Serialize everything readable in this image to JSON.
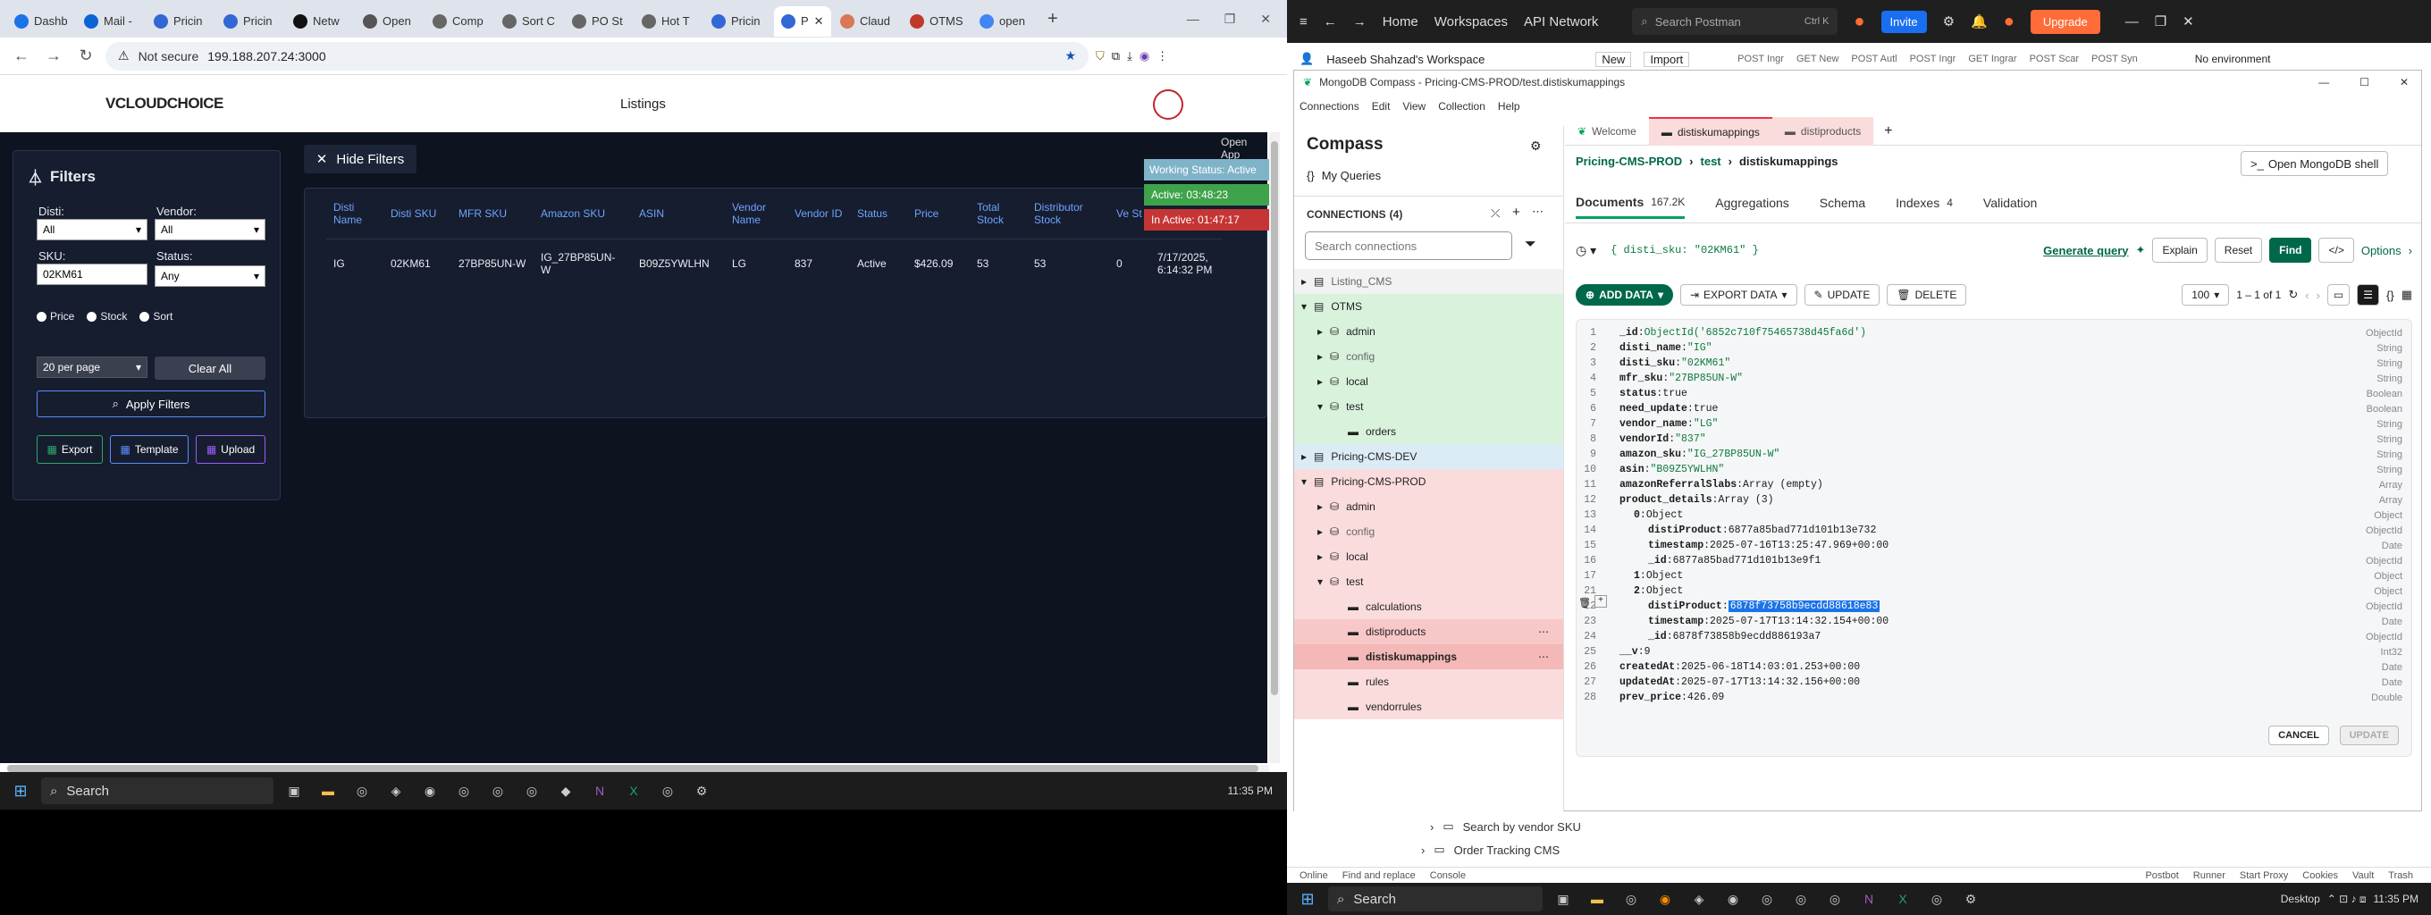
{
  "chrome": {
    "tabs": [
      "Dashb",
      "Mail -",
      "Pricin",
      "Pricin",
      "Netw",
      "Open",
      "Comp",
      "Sort C",
      "PO St",
      "Hot T",
      "Pricin",
      "P",
      "Claud",
      "OTMS",
      "open"
    ],
    "new_tab": "+",
    "not_secure": "Not secure",
    "url": "199.188.207.24:3000"
  },
  "app": {
    "logo": "VCLOUDCHOICE",
    "title": "Listings",
    "open_app": "Open App",
    "hide_filters": "Hide Filters",
    "filters_title": "Filters",
    "disti_label": "Disti:",
    "disti_value": "All",
    "vendor_label": "Vendor:",
    "vendor_value": "All",
    "sku_label": "SKU:",
    "sku_value": "02KM61",
    "status_label": "Status:",
    "status_value": "Any",
    "radio_price": "Price",
    "radio_stock": "Stock",
    "radio_sort": "Sort",
    "per_page": "20 per page",
    "clear_all": "Clear All",
    "apply_filters": "Apply Filters",
    "export": "Export",
    "template": "Template",
    "upload": "Upload",
    "working_status": "Working Status: Active",
    "active_time": "Active: 03:48:23",
    "inactive_time": "In Active: 01:47:17",
    "columns": [
      "Disti Name",
      "Disti SKU",
      "MFR SKU",
      "Amazon SKU",
      "ASIN",
      "Vendor Name",
      "Vendor ID",
      "Status",
      "Price",
      "Total Stock",
      "Distributor Stock",
      "Ve St"
    ],
    "row": [
      "IG",
      "02KM61",
      "27BP85UN-W",
      "IG_27BP85UN-W",
      "B09Z5YWLHN",
      "LG",
      "837",
      "Active",
      "$426.09",
      "53",
      "53",
      "0",
      "7/17/2025, 6:14:32 PM"
    ]
  },
  "taskbar_left": {
    "search": "Search",
    "time": "11:35 PM"
  },
  "postman": {
    "home": "Home",
    "workspaces": "Workspaces",
    "api_network": "API Network",
    "search": "Search Postman",
    "shortcut": "Ctrl K",
    "invite": "Invite",
    "upgrade": "Upgrade",
    "workspace_name": "Haseeb Shahzad's Workspace",
    "new": "New",
    "import": "Import",
    "req_tabs": [
      "POST Ingr",
      "GET New",
      "POST Autl",
      "POST Ingr",
      "GET Ingrar",
      "POST Scar",
      "POST Syn"
    ],
    "no_env": "No environment",
    "bottom_items": [
      "Search by vendor SKU",
      "Order Tracking CMS"
    ],
    "status_left": [
      "Online",
      "Find and replace",
      "Console"
    ],
    "status_right": [
      "Postbot",
      "Runner",
      "Start Proxy",
      "Cookies",
      "Vault",
      "Trash"
    ]
  },
  "compass": {
    "window_title": "MongoDB Compass - Pricing-CMS-PROD/test.distiskumappings",
    "menu": [
      "Connections",
      "Edit",
      "View",
      "Collection",
      "Help"
    ],
    "brand": "Compass",
    "my_queries": "My Queries",
    "connections_label": "CONNECTIONS",
    "connections_count": "(4)",
    "search_connections": "Search connections",
    "tree": [
      {
        "label": "Listing_CMS",
        "level": 0
      },
      {
        "label": "OTMS",
        "level": 0
      },
      {
        "label": "admin",
        "level": 1
      },
      {
        "label": "config",
        "level": 1
      },
      {
        "label": "local",
        "level": 1
      },
      {
        "label": "test",
        "level": 1
      },
      {
        "label": "orders",
        "level": 2
      },
      {
        "label": "Pricing-CMS-DEV",
        "level": 0
      },
      {
        "label": "Pricing-CMS-PROD",
        "level": 0
      },
      {
        "label": "admin",
        "level": 1
      },
      {
        "label": "config",
        "level": 1
      },
      {
        "label": "local",
        "level": 1
      },
      {
        "label": "test",
        "level": 1
      },
      {
        "label": "calculations",
        "level": 2
      },
      {
        "label": "distiproducts",
        "level": 2
      },
      {
        "label": "distiskumappings",
        "level": 2
      },
      {
        "label": "rules",
        "level": 2
      },
      {
        "label": "vendorrules",
        "level": 2
      }
    ],
    "tabs": [
      "Welcome",
      "distiskumappings",
      "distiproducts"
    ],
    "breadcrumb": [
      "Pricing-CMS-PROD",
      "test",
      "distiskumappings"
    ],
    "open_shell": "Open MongoDB shell",
    "subtabs": [
      "Documents",
      "Aggregations",
      "Schema",
      "Indexes",
      "Validation"
    ],
    "documents_count": "167.2K",
    "indexes_count": "4",
    "query": "{ disti_sku: \"02KM61\" }",
    "generate_query": "Generate query",
    "explain": "Explain",
    "reset": "Reset",
    "find": "Find",
    "options": "Options",
    "add_data": "ADD DATA",
    "export_data": "EXPORT DATA",
    "update": "UPDATE",
    "delete": "DELETE",
    "page_size": "100",
    "range": "1 – 1 of 1",
    "cancel": "CANCEL",
    "update_btn": "UPDATE",
    "doc_lines": [
      {
        "k": "_id",
        "v": "ObjectId('6852c710f75465738d45fa6d')",
        "t": "ObjectId",
        "i": 0,
        "c": "s"
      },
      {
        "k": "disti_name",
        "v": "\"IG\"",
        "t": "String",
        "i": 0,
        "c": "s"
      },
      {
        "k": "disti_sku",
        "v": "\"02KM61\"",
        "t": "String",
        "i": 0,
        "c": "s"
      },
      {
        "k": "mfr_sku",
        "v": "\"27BP85UN-W\"",
        "t": "String",
        "i": 0,
        "c": "s"
      },
      {
        "k": "status",
        "v": "true",
        "t": "Boolean",
        "i": 0,
        "c": "n"
      },
      {
        "k": "need_update",
        "v": "true",
        "t": "Boolean",
        "i": 0,
        "c": "n"
      },
      {
        "k": "vendor_name",
        "v": "\"LG\"",
        "t": "String",
        "i": 0,
        "c": "s"
      },
      {
        "k": "vendorId",
        "v": "\"837\"",
        "t": "String",
        "i": 0,
        "c": "s"
      },
      {
        "k": "amazon_sku",
        "v": "\"IG_27BP85UN-W\"",
        "t": "String",
        "i": 0,
        "c": "s"
      },
      {
        "k": "asin",
        "v": "\"B09Z5YWLHN\"",
        "t": "String",
        "i": 0,
        "c": "s"
      },
      {
        "k": "amazonReferralSlabs",
        "v": "Array (empty)",
        "t": "Array",
        "i": 0,
        "c": "n"
      },
      {
        "k": "product_details",
        "v": "Array (3)",
        "t": "Array",
        "i": 0,
        "c": "n"
      },
      {
        "k": "0",
        "v": "Object",
        "t": "Object",
        "i": 1,
        "c": "n"
      },
      {
        "k": "distiProduct",
        "v": "6877a85bad771d101b13e732",
        "t": "ObjectId",
        "i": 2,
        "c": "n"
      },
      {
        "k": "timestamp",
        "v": "2025-07-16T13:25:47.969+00:00",
        "t": "Date",
        "i": 2,
        "c": "n"
      },
      {
        "k": "_id",
        "v": "6877a85bad771d101b13e9f1",
        "t": "ObjectId",
        "i": 2,
        "c": "n"
      },
      {
        "k": "1",
        "v": "Object",
        "t": "Object",
        "i": 1,
        "c": "n"
      },
      {
        "k": "2",
        "v": "Object",
        "t": "Object",
        "i": 1,
        "c": "n"
      },
      {
        "k": "distiProduct",
        "v": "6878f73758b9ecdd88618e83",
        "t": "ObjectId",
        "i": 2,
        "c": "h"
      },
      {
        "k": "timestamp",
        "v": "2025-07-17T13:14:32.154+00:00",
        "t": "Date",
        "i": 2,
        "c": "n"
      },
      {
        "k": "_id",
        "v": "6878f73858b9ecdd886193a7",
        "t": "ObjectId",
        "i": 2,
        "c": "n"
      },
      {
        "k": "__v",
        "v": "9",
        "t": "Int32",
        "i": 0,
        "c": "n"
      },
      {
        "k": "createdAt",
        "v": "2025-06-18T14:03:01.253+00:00",
        "t": "Date",
        "i": 0,
        "c": "n"
      },
      {
        "k": "updatedAt",
        "v": "2025-07-17T13:14:32.156+00:00",
        "t": "Date",
        "i": 0,
        "c": "n"
      },
      {
        "k": "prev_price",
        "v": "426.09",
        "t": "Double",
        "i": 0,
        "c": "n"
      }
    ],
    "line_numbers": [
      "1",
      "2",
      "3",
      "4",
      "5",
      "6",
      "7",
      "8",
      "9",
      "10",
      "11",
      "12",
      "13",
      "14",
      "15",
      "16",
      "17",
      "21",
      "22",
      "23",
      "24",
      "25",
      "26",
      "27",
      "28"
    ]
  },
  "taskbar_right": {
    "search": "Search",
    "desktop": "Desktop",
    "time": "11:35 PM"
  }
}
